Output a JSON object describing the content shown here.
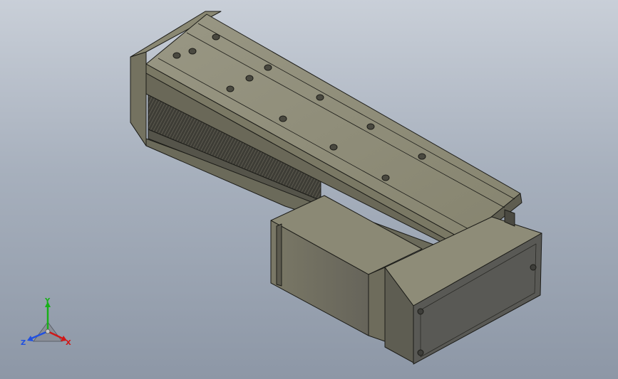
{
  "viewport": {
    "background_top": "#c9cfd8",
    "background_bottom": "#8d97a6",
    "model_colors": {
      "top_face": "#8e8c78",
      "side_face": "#6e6c5c",
      "dark_face": "#4e4d44",
      "edge": "#1c1c18",
      "motor_cover": "#5a5a56"
    }
  },
  "triad": {
    "x_axis_label": "X",
    "y_axis_label": "Y",
    "z_axis_label": "Z",
    "x_color": "#d01818",
    "y_color": "#18b018",
    "z_color": "#2050e0"
  }
}
